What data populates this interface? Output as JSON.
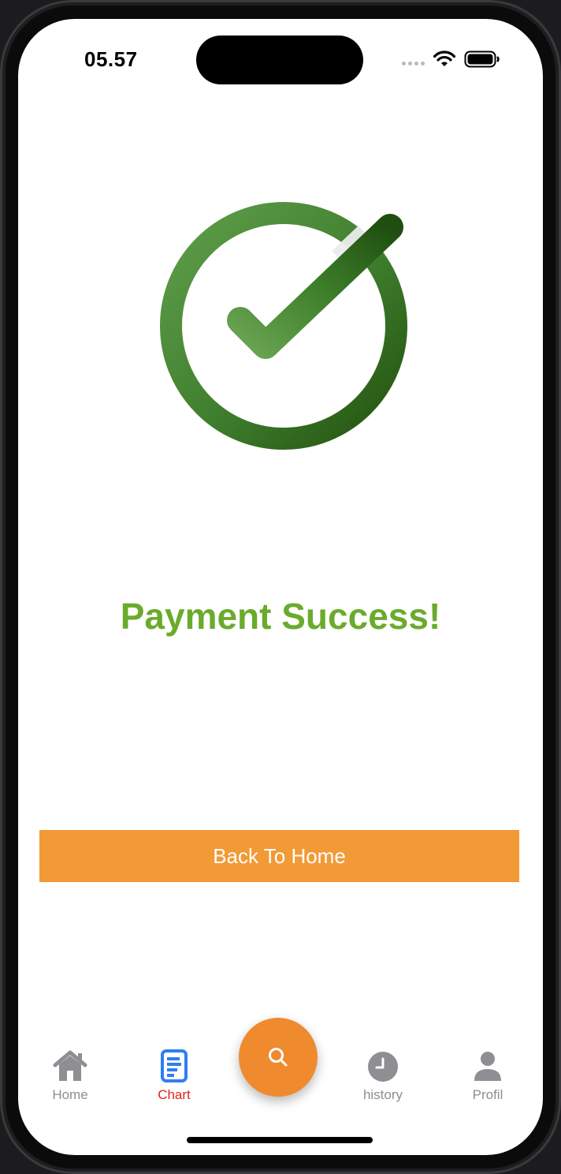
{
  "status_bar": {
    "time": "05.57",
    "icons": [
      "signal-dots-icon",
      "wifi-icon",
      "battery-icon"
    ]
  },
  "main": {
    "graphic": "check-circle-icon",
    "title": "Payment Success!",
    "button_label": "Back To Home"
  },
  "tabbar": {
    "items": [
      {
        "label": "Home",
        "icon": "home-icon",
        "active": false
      },
      {
        "label": "Chart",
        "icon": "chart-icon",
        "active": true
      },
      {
        "label": "history",
        "icon": "clock-icon",
        "active": false
      },
      {
        "label": "Profil",
        "icon": "person-icon",
        "active": false
      }
    ],
    "fab_icon": "search-icon"
  },
  "colors": {
    "title_green": "#6aab2c",
    "button_orange": "#f29a36",
    "fab_orange": "#f08a2e",
    "active_tab_red": "#e2231a",
    "active_icon_blue": "#2f7ef2",
    "inactive_gray": "#8e8e93"
  }
}
